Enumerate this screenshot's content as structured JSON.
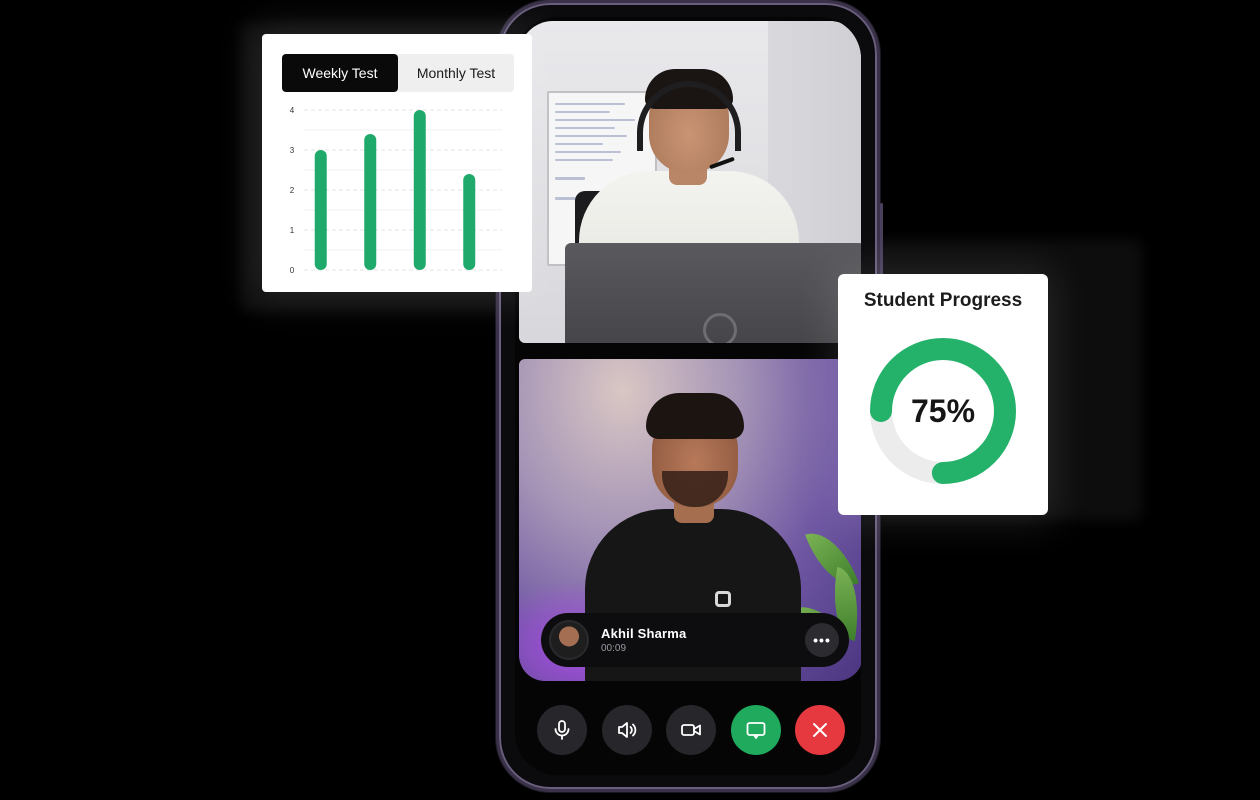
{
  "chart_card": {
    "tabs": [
      {
        "label": "Weekly Test",
        "active": true
      },
      {
        "label": "Monthly Test",
        "active": false
      }
    ]
  },
  "chart_data": {
    "type": "bar",
    "categories": [
      "",
      "",
      "",
      ""
    ],
    "values": [
      3.0,
      3.4,
      4.0,
      2.4
    ],
    "ylim": [
      0,
      4
    ],
    "yticks": [
      "0",
      "1",
      "2",
      "3",
      "4"
    ],
    "grid": true,
    "bar_color": "#1faa6b"
  },
  "progress_card": {
    "title": "Student Progress",
    "value_label": "75%",
    "percent": 75,
    "ring_color": "#24b26b",
    "track_color": "#ececec"
  },
  "call": {
    "caller_name": "Akhil Sharma",
    "duration": "00:09",
    "more_label": "•••"
  },
  "controls": [
    {
      "name": "mic-icon"
    },
    {
      "name": "speaker-icon"
    },
    {
      "name": "video-camera-icon"
    },
    {
      "name": "chat-icon"
    },
    {
      "name": "end-call-icon"
    }
  ],
  "colors": {
    "accent_green": "#1faa5e",
    "end_call_red": "#e5393f"
  }
}
